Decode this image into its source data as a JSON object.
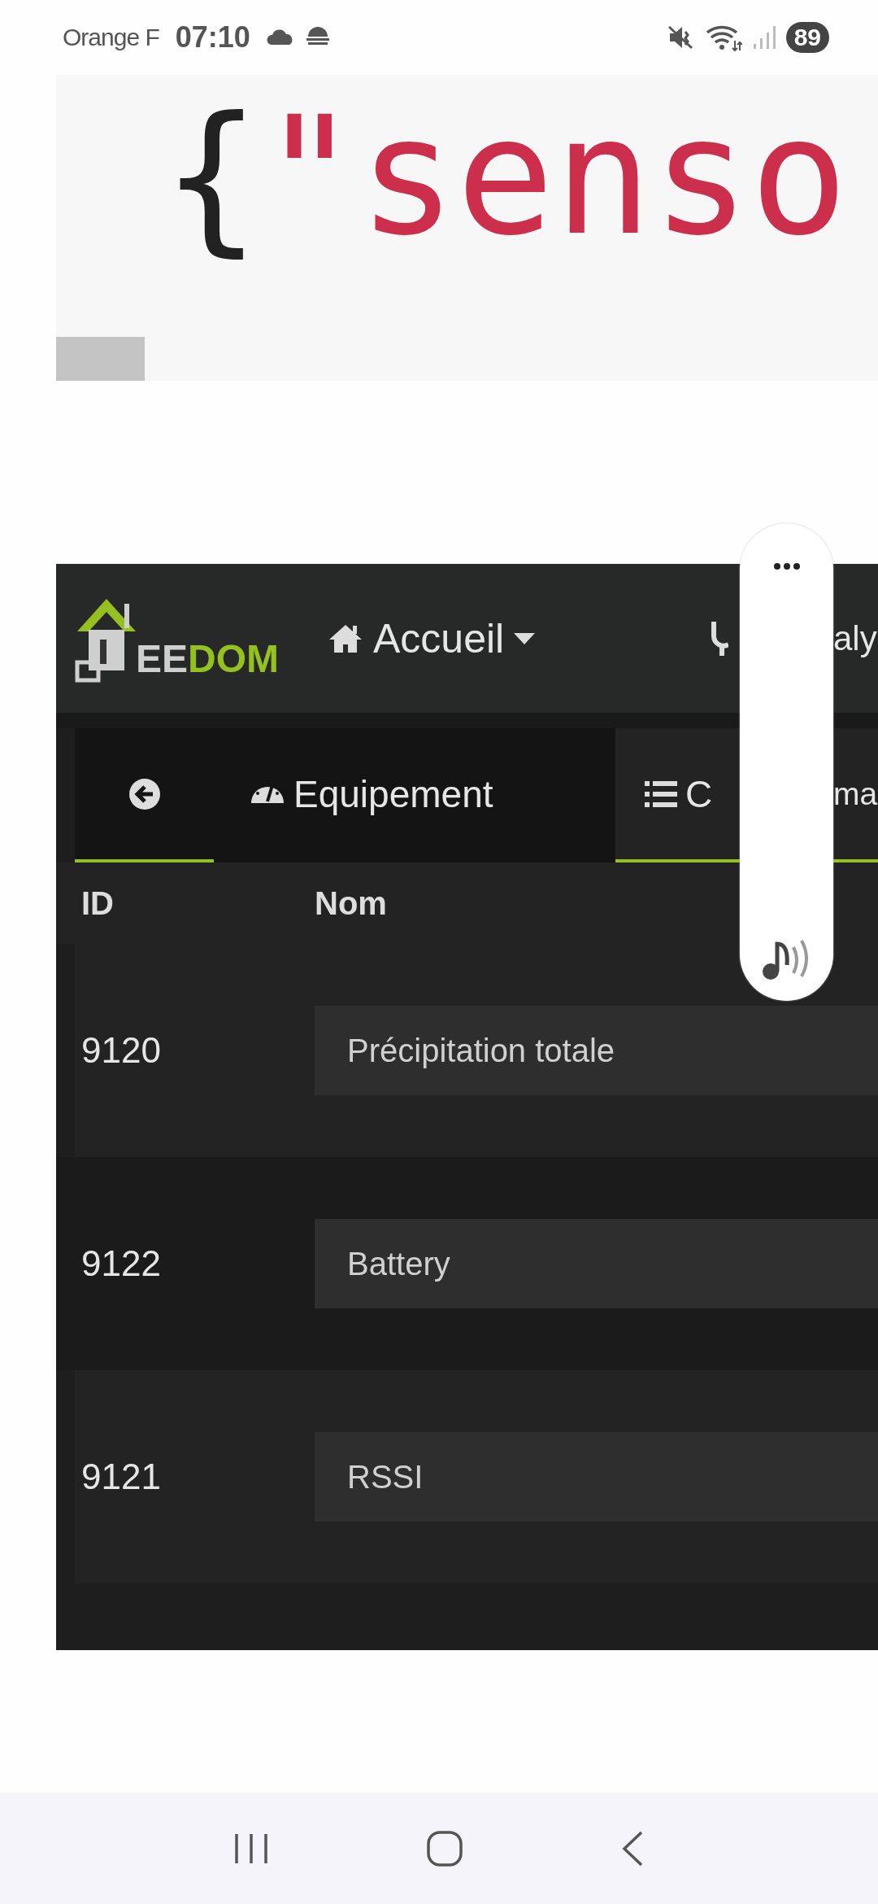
{
  "status_bar": {
    "carrier": "Orange F",
    "time": "07:10",
    "battery": "89"
  },
  "code": {
    "brace": "{",
    "string": "\"senso"
  },
  "jeedom": {
    "logo": {
      "part_1": "EE",
      "part_2": "DOM"
    },
    "nav": [
      {
        "kind": "home",
        "label": "Accueil"
      },
      {
        "kind": "cut",
        "label": "aly"
      }
    ],
    "tabs": [
      {
        "kind": "back",
        "selected": false
      },
      {
        "kind": "gauge",
        "label": "Equipement",
        "selected": false
      },
      {
        "kind": "list",
        "label": "C",
        "label_after": "ma",
        "selected": true
      }
    ],
    "columns": [
      "ID",
      "Nom"
    ],
    "rows": [
      {
        "id": "9120",
        "name": "Précipitation totale"
      },
      {
        "id": "9122",
        "name": "Battery"
      },
      {
        "id": "9121",
        "name": "RSSI"
      }
    ]
  }
}
